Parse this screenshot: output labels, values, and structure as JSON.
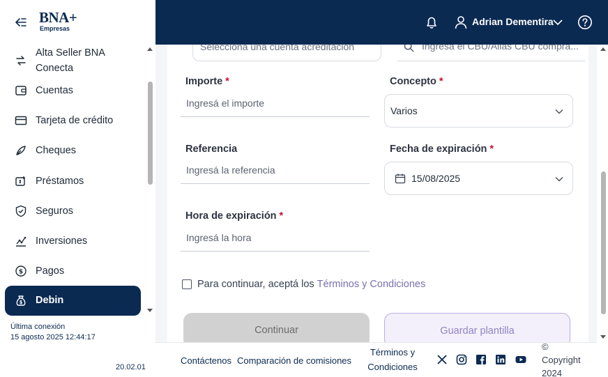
{
  "brand": {
    "name": "BNA+",
    "sub": "Empresas"
  },
  "sidebar": {
    "items": [
      {
        "label": "Alta Seller BNA Conecta"
      },
      {
        "label": "Cuentas"
      },
      {
        "label": "Tarjeta de crédito"
      },
      {
        "label": "Cheques"
      },
      {
        "label": "Préstamos"
      },
      {
        "label": "Seguros"
      },
      {
        "label": "Inversiones"
      },
      {
        "label": "Pagos"
      },
      {
        "label": "Debin",
        "active": true
      }
    ],
    "last_connection_label": "Última conexión",
    "last_connection_value": "15 agosto 2025 12:44:17",
    "version": "20.02.01"
  },
  "topbar": {
    "user_name": "Adrian Dementira"
  },
  "form": {
    "account_select_placeholder": "Seleccioná una cuenta acreditación",
    "cbu_search_placeholder": "Ingresá el CBU/Alias CBU compra...",
    "amount": {
      "label": "Importe",
      "placeholder": "Ingresá el importe",
      "required": "*"
    },
    "concept": {
      "label": "Concepto",
      "value": "Varios",
      "required": "*"
    },
    "reference": {
      "label": "Referencia",
      "placeholder": "Ingresá la referencia"
    },
    "expiration_date": {
      "label": "Fecha de expiración",
      "value": "15/08/2025",
      "required": "*"
    },
    "expiration_time": {
      "label": "Hora de expiración",
      "placeholder": "Ingresá la hora",
      "required": "*"
    },
    "terms_text": "Para continuar, aceptá los",
    "terms_link": "Términos y Condiciones",
    "continue_label": "Continuar",
    "save_template_label": "Guardar plantilla"
  },
  "footer": {
    "contact": "Contáctenos",
    "commissions": "Comparación de comisiones",
    "terms_line1": "Términos y",
    "terms_line2": "Condiciones",
    "copyright_symbol": "©",
    "copyright_word": "Copyright",
    "copyright_year": "2024"
  },
  "icons": [
    "collapse-icon",
    "link-icon",
    "wallet-icon",
    "credit-card-icon",
    "feather-icon",
    "loan-icon",
    "shield-icon",
    "chart-icon",
    "coin-icon",
    "money-bag-icon",
    "bell-icon",
    "user-icon",
    "chevron-down-icon",
    "help-icon",
    "search-icon",
    "calendar-icon",
    "x-icon",
    "instagram-icon",
    "facebook-icon",
    "linkedin-icon",
    "youtube-icon"
  ],
  "colors": {
    "primary": "#0b2a52",
    "accent_link": "#7a6fae",
    "required": "#c8102e"
  }
}
